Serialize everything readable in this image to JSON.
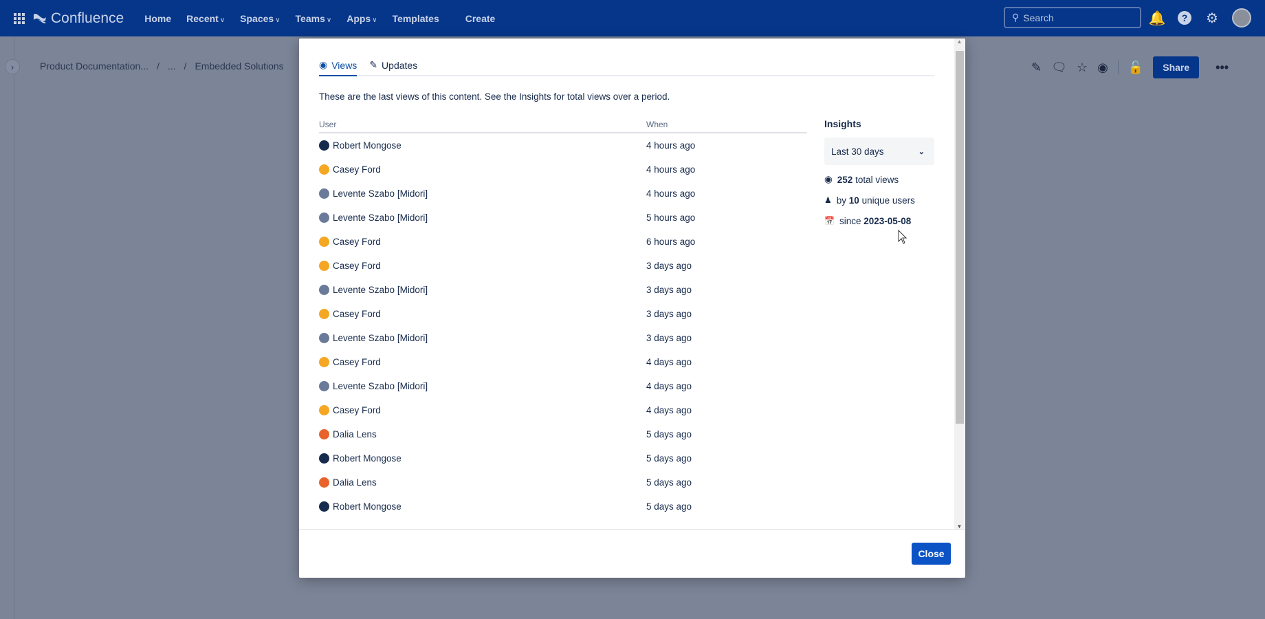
{
  "topbar": {
    "app_name": "Confluence",
    "nav": [
      {
        "label": "Home",
        "dropdown": false
      },
      {
        "label": "Recent",
        "dropdown": true
      },
      {
        "label": "Spaces",
        "dropdown": true
      },
      {
        "label": "Teams",
        "dropdown": true
      },
      {
        "label": "Apps",
        "dropdown": true
      },
      {
        "label": "Templates",
        "dropdown": false
      },
      {
        "label": "Create",
        "dropdown": false
      }
    ],
    "search_placeholder": "Search"
  },
  "breadcrumb": [
    "Product Documentation...",
    "/",
    "...",
    "/",
    "Embedded Solutions"
  ],
  "page_actions": {
    "share_label": "Share"
  },
  "modal": {
    "tabs": [
      {
        "label": "Views",
        "active": true
      },
      {
        "label": "Updates",
        "active": false
      }
    ],
    "intro": "These are the last views of this content. See the Insights for total views over a period.",
    "columns": {
      "user": "User",
      "when": "When"
    },
    "rows": [
      {
        "user": "Robert Mongose",
        "when": "4 hours ago",
        "avatar": "#172b4d"
      },
      {
        "user": "Casey Ford",
        "when": "4 hours ago",
        "avatar": "#f5a623"
      },
      {
        "user": "Levente Szabo [Midori]",
        "when": "4 hours ago",
        "avatar": "#6b7a99"
      },
      {
        "user": "Levente Szabo [Midori]",
        "when": "5 hours ago",
        "avatar": "#6b7a99"
      },
      {
        "user": "Casey Ford",
        "when": "6 hours ago",
        "avatar": "#f5a623"
      },
      {
        "user": "Casey Ford",
        "when": "3 days ago",
        "avatar": "#f5a623"
      },
      {
        "user": "Levente Szabo [Midori]",
        "when": "3 days ago",
        "avatar": "#6b7a99"
      },
      {
        "user": "Casey Ford",
        "when": "3 days ago",
        "avatar": "#f5a623"
      },
      {
        "user": "Levente Szabo [Midori]",
        "when": "3 days ago",
        "avatar": "#6b7a99"
      },
      {
        "user": "Casey Ford",
        "when": "4 days ago",
        "avatar": "#f5a623"
      },
      {
        "user": "Levente Szabo [Midori]",
        "when": "4 days ago",
        "avatar": "#6b7a99"
      },
      {
        "user": "Casey Ford",
        "when": "4 days ago",
        "avatar": "#f5a623"
      },
      {
        "user": "Dalia Lens",
        "when": "5 days ago",
        "avatar": "#e8632b"
      },
      {
        "user": "Robert Mongose",
        "when": "5 days ago",
        "avatar": "#172b4d"
      },
      {
        "user": "Dalia Lens",
        "when": "5 days ago",
        "avatar": "#e8632b"
      },
      {
        "user": "Robert Mongose",
        "when": "5 days ago",
        "avatar": "#172b4d"
      }
    ],
    "insights": {
      "title": "Insights",
      "period": "Last 30 days",
      "total_views": "252",
      "total_views_label": "total views",
      "by_label": "by",
      "unique_users": "10",
      "unique_users_label": "unique users",
      "since_label": "since",
      "since_date": "2023-05-08"
    },
    "close_label": "Close"
  }
}
